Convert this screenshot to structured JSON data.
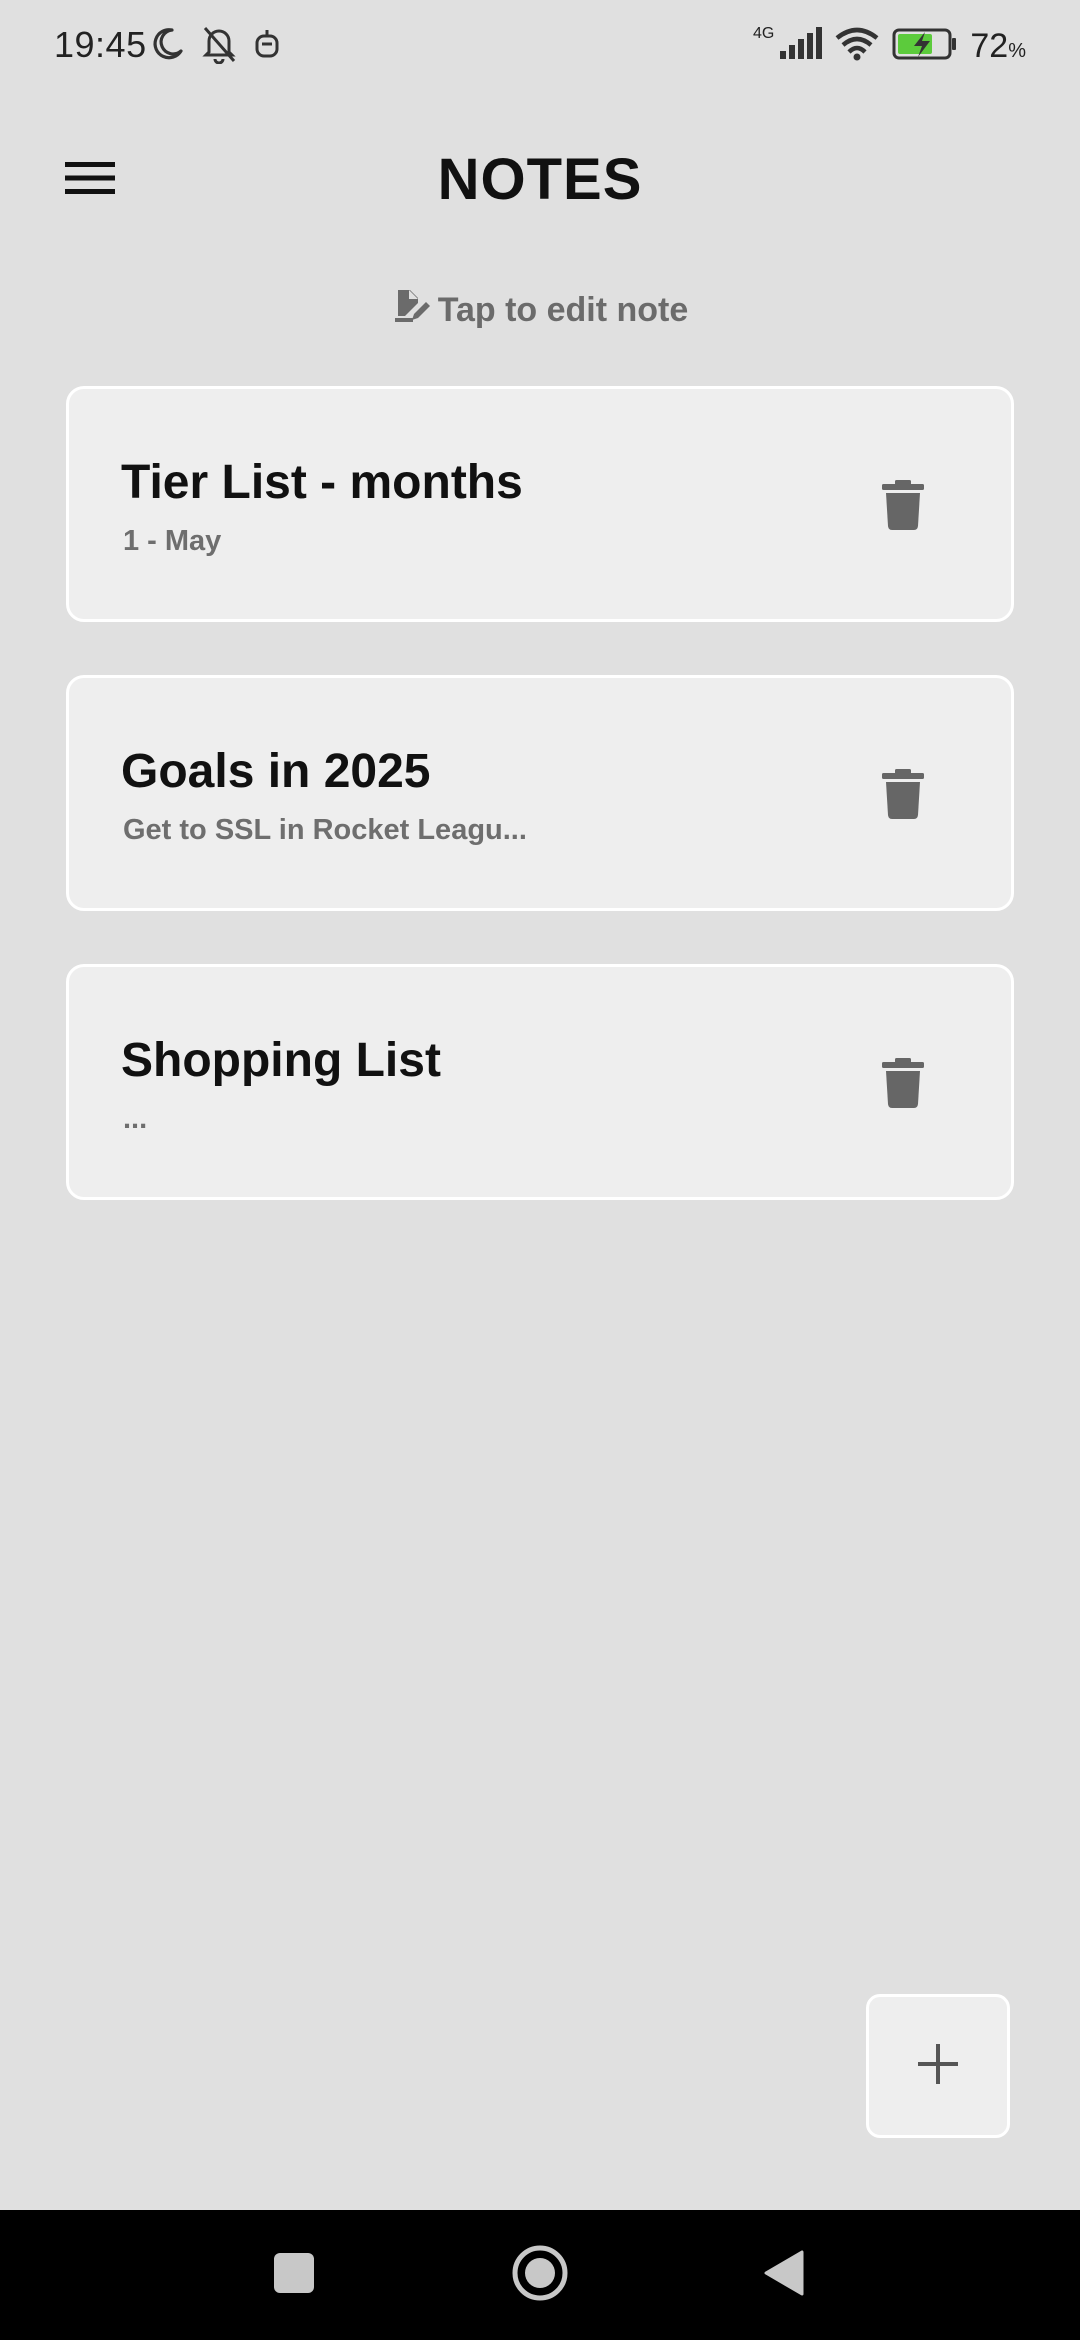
{
  "status_bar": {
    "time": "19:45",
    "network": "4G",
    "battery_value": "72",
    "battery_unit": "%",
    "icons": [
      "moon-icon",
      "bell-off-icon",
      "robot-icon",
      "signal-icon",
      "wifi-icon",
      "battery-charging-icon"
    ]
  },
  "app_bar": {
    "title": "NOTES",
    "menu_icon": "hamburger-menu-icon"
  },
  "hint": {
    "text": "Tap to edit note",
    "icon": "edit-note-icon"
  },
  "notes": [
    {
      "title": "Tier List - months",
      "preview": "1 - May"
    },
    {
      "title": "Goals in 2025",
      "preview": "Get to SSL in Rocket Leagu..."
    },
    {
      "title": "Shopping List",
      "preview": "..."
    }
  ],
  "fab": {
    "icon": "plus-icon"
  },
  "nav_bar": {
    "icons": [
      "recents-square-icon",
      "home-circle-icon",
      "back-triangle-icon"
    ]
  },
  "colors": {
    "background": "#e0e0e0",
    "card": "#eeeeee",
    "card_border": "#ffffff",
    "title_text": "#111111",
    "secondary_text": "#6e6e6e",
    "icon": "#666666",
    "charging": "#5ccb3c"
  }
}
